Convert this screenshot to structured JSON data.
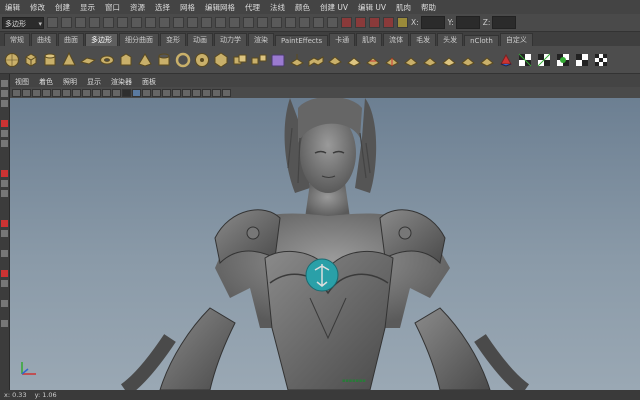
{
  "menus": [
    "编辑",
    "修改",
    "创建",
    "显示",
    "窗口",
    "资源",
    "选择",
    "网格",
    "编辑网格",
    "代理",
    "法线",
    "颜色",
    "创建 UV",
    "编辑 UV",
    "肌肉",
    "帮助"
  ],
  "status": {
    "mode": "多边形",
    "coord_labels": [
      "X:",
      "Y:",
      "Z:"
    ]
  },
  "shelf_tabs": [
    "常规",
    "曲线",
    "曲面",
    "多边形",
    "细分曲面",
    "变形",
    "动画",
    "动力学",
    "渲染",
    "PaintEffects",
    "卡通",
    "肌肉",
    "流体",
    "毛发",
    "头发",
    "nCloth",
    "自定义"
  ],
  "active_shelf_tab": "多边形",
  "panel_menus": [
    "视图",
    "着色",
    "照明",
    "显示",
    "渲染器",
    "面板"
  ],
  "viewport": {
    "label": "persp",
    "badge_text": "▪▪▪▪▪▪▪"
  },
  "status_bar": {
    "x": "x: 0.33",
    "y": "y: 1.06"
  }
}
